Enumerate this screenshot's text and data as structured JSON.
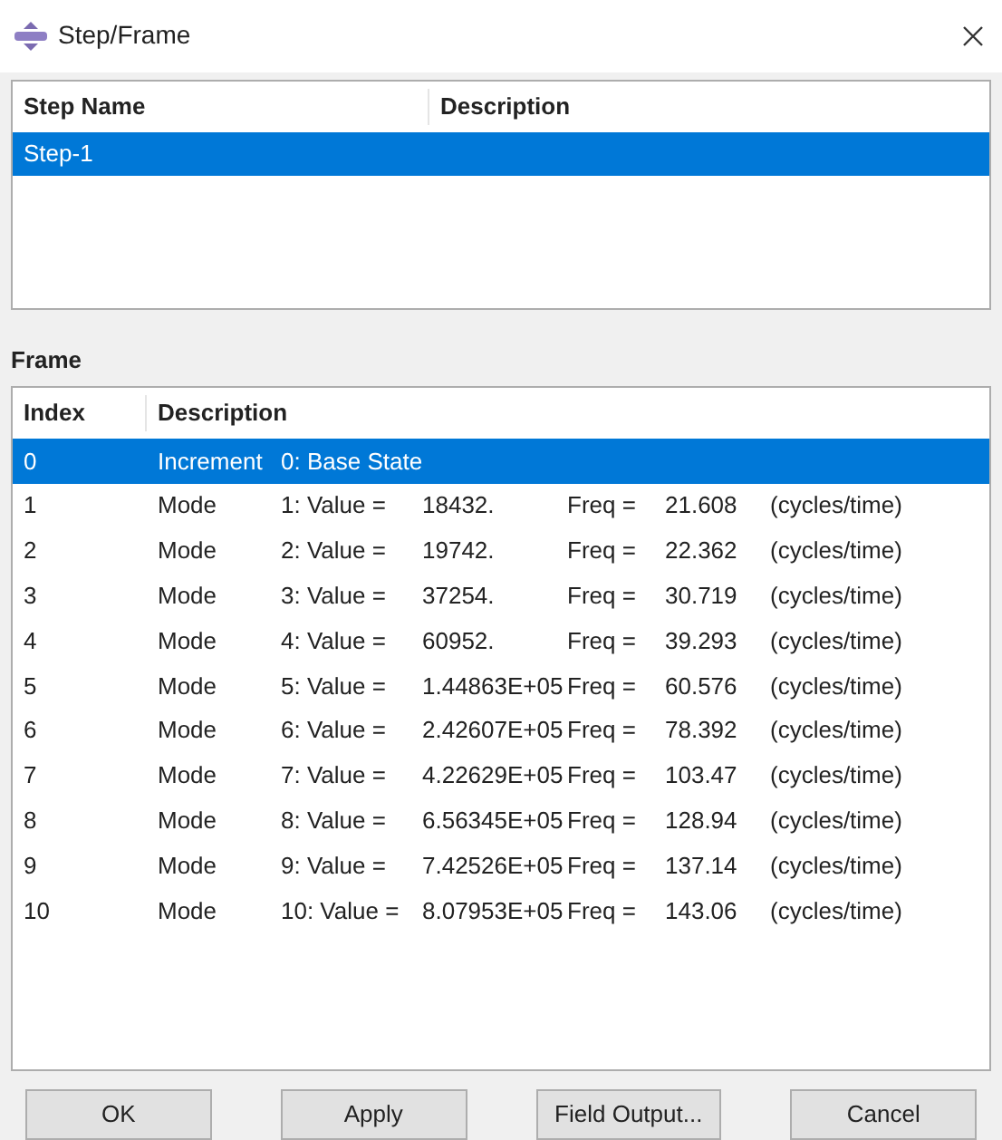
{
  "window": {
    "title": "Step/Frame"
  },
  "steps": {
    "columns": [
      "Step Name",
      "Description"
    ],
    "rows": [
      {
        "name": "Step-1",
        "description": "",
        "selected": true
      }
    ]
  },
  "frame": {
    "label": "Frame",
    "columns": [
      "Index",
      "Description"
    ],
    "rows": [
      {
        "index": "0",
        "type": "Increment",
        "parts": [
          "0: Base State"
        ],
        "selected": true
      },
      {
        "index": "1",
        "type": "Mode",
        "parts": [
          "1: Value =",
          "18432.",
          "Freq =",
          "21.608",
          "(cycles/time)"
        ],
        "selected": false
      },
      {
        "index": "2",
        "type": "Mode",
        "parts": [
          "2: Value =",
          "19742.",
          "Freq =",
          "22.362",
          "(cycles/time)"
        ],
        "selected": false
      },
      {
        "index": "3",
        "type": "Mode",
        "parts": [
          "3: Value =",
          "37254.",
          "Freq =",
          "30.719",
          "(cycles/time)"
        ],
        "selected": false
      },
      {
        "index": "4",
        "type": "Mode",
        "parts": [
          "4: Value =",
          "60952.",
          "Freq =",
          "39.293",
          "(cycles/time)"
        ],
        "selected": false
      },
      {
        "index": "5",
        "type": "Mode",
        "parts": [
          "5: Value =",
          "1.44863E+05",
          "Freq =",
          "60.576",
          "(cycles/time)"
        ],
        "selected": false
      },
      {
        "index": "6",
        "type": "Mode",
        "parts": [
          "6: Value =",
          "2.42607E+05",
          "Freq =",
          "78.392",
          "(cycles/time)"
        ],
        "selected": false
      },
      {
        "index": "7",
        "type": "Mode",
        "parts": [
          "7: Value =",
          "4.22629E+05",
          "Freq =",
          "103.47",
          "(cycles/time)"
        ],
        "selected": false
      },
      {
        "index": "8",
        "type": "Mode",
        "parts": [
          "8: Value =",
          "6.56345E+05",
          "Freq =",
          "128.94",
          "(cycles/time)"
        ],
        "selected": false
      },
      {
        "index": "9",
        "type": "Mode",
        "parts": [
          "9: Value =",
          "7.42526E+05",
          "Freq =",
          "137.14",
          "(cycles/time)"
        ],
        "selected": false
      },
      {
        "index": "10",
        "type": "Mode",
        "parts": [
          "10: Value =",
          "8.07953E+05",
          "Freq =",
          "143.06",
          "(cycles/time)"
        ],
        "selected": false
      }
    ]
  },
  "buttons": [
    "OK",
    "Apply",
    "Field Output...",
    "Cancel"
  ]
}
